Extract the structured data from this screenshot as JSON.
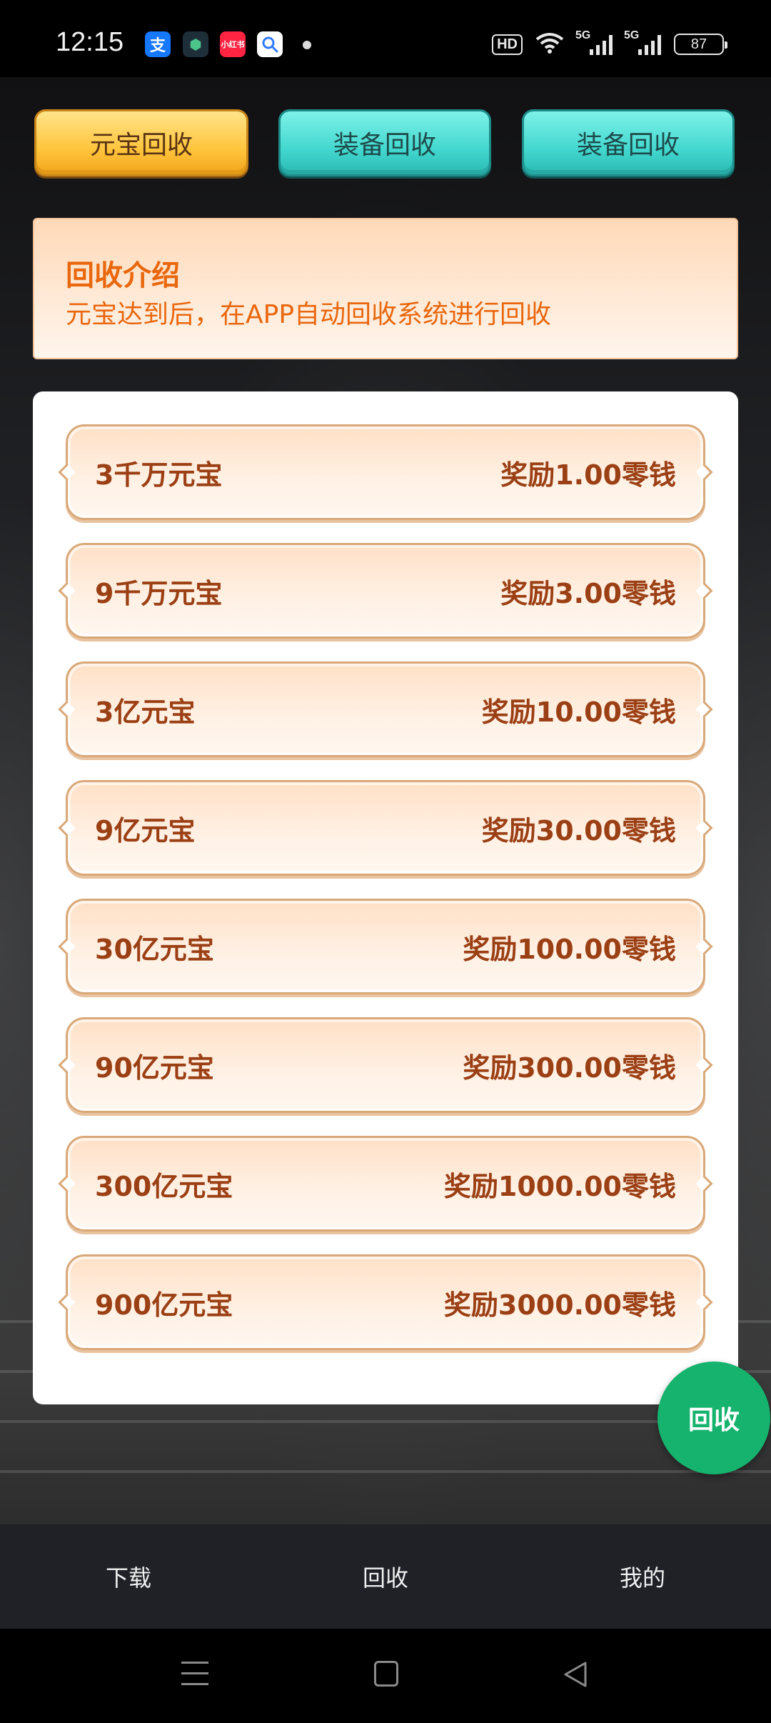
{
  "status_bar": {
    "time": "12:15",
    "apps": [
      {
        "icon": "alipay-icon",
        "glyph": "支"
      },
      {
        "icon": "shield-app-icon",
        "glyph": "⬢"
      },
      {
        "icon": "xiaohongshu-icon",
        "glyph": "小红书"
      },
      {
        "icon": "search-app-icon",
        "glyph": "🔍"
      }
    ],
    "hd_label": "HD",
    "network_1": "5G",
    "network_2": "5G",
    "battery": "87"
  },
  "tabs": [
    {
      "label": "元宝回收",
      "active": true,
      "color": "#ffc53d"
    },
    {
      "label": "装备回收",
      "active": false,
      "color": "#43d8cf"
    },
    {
      "label": "装备回收",
      "active": false,
      "color": "#43d8cf"
    }
  ],
  "intro": {
    "title": "回收介绍",
    "description": "元宝达到后，在APP自动回收系统进行回收"
  },
  "recycle_list": [
    {
      "amount": "3千万元宝",
      "reward": "奖励1.00零钱"
    },
    {
      "amount": "9千万元宝",
      "reward": "奖励3.00零钱"
    },
    {
      "amount": "3亿元宝",
      "reward": "奖励10.00零钱"
    },
    {
      "amount": "9亿元宝",
      "reward": "奖励30.00零钱"
    },
    {
      "amount": "30亿元宝",
      "reward": "奖励100.00零钱"
    },
    {
      "amount": "90亿元宝",
      "reward": "奖励300.00零钱"
    },
    {
      "amount": "300亿元宝",
      "reward": "奖励1000.00零钱"
    },
    {
      "amount": "900亿元宝",
      "reward": "奖励3000.00零钱"
    }
  ],
  "fab": {
    "label": "回收",
    "color": "#16b36e"
  },
  "bottom_nav": [
    {
      "label": "下载"
    },
    {
      "label": "回收"
    },
    {
      "label": "我的"
    }
  ],
  "colors": {
    "accent_orange": "#e9670d",
    "item_text": "#9b3f14",
    "tabbar_bg": "#1f2127"
  }
}
